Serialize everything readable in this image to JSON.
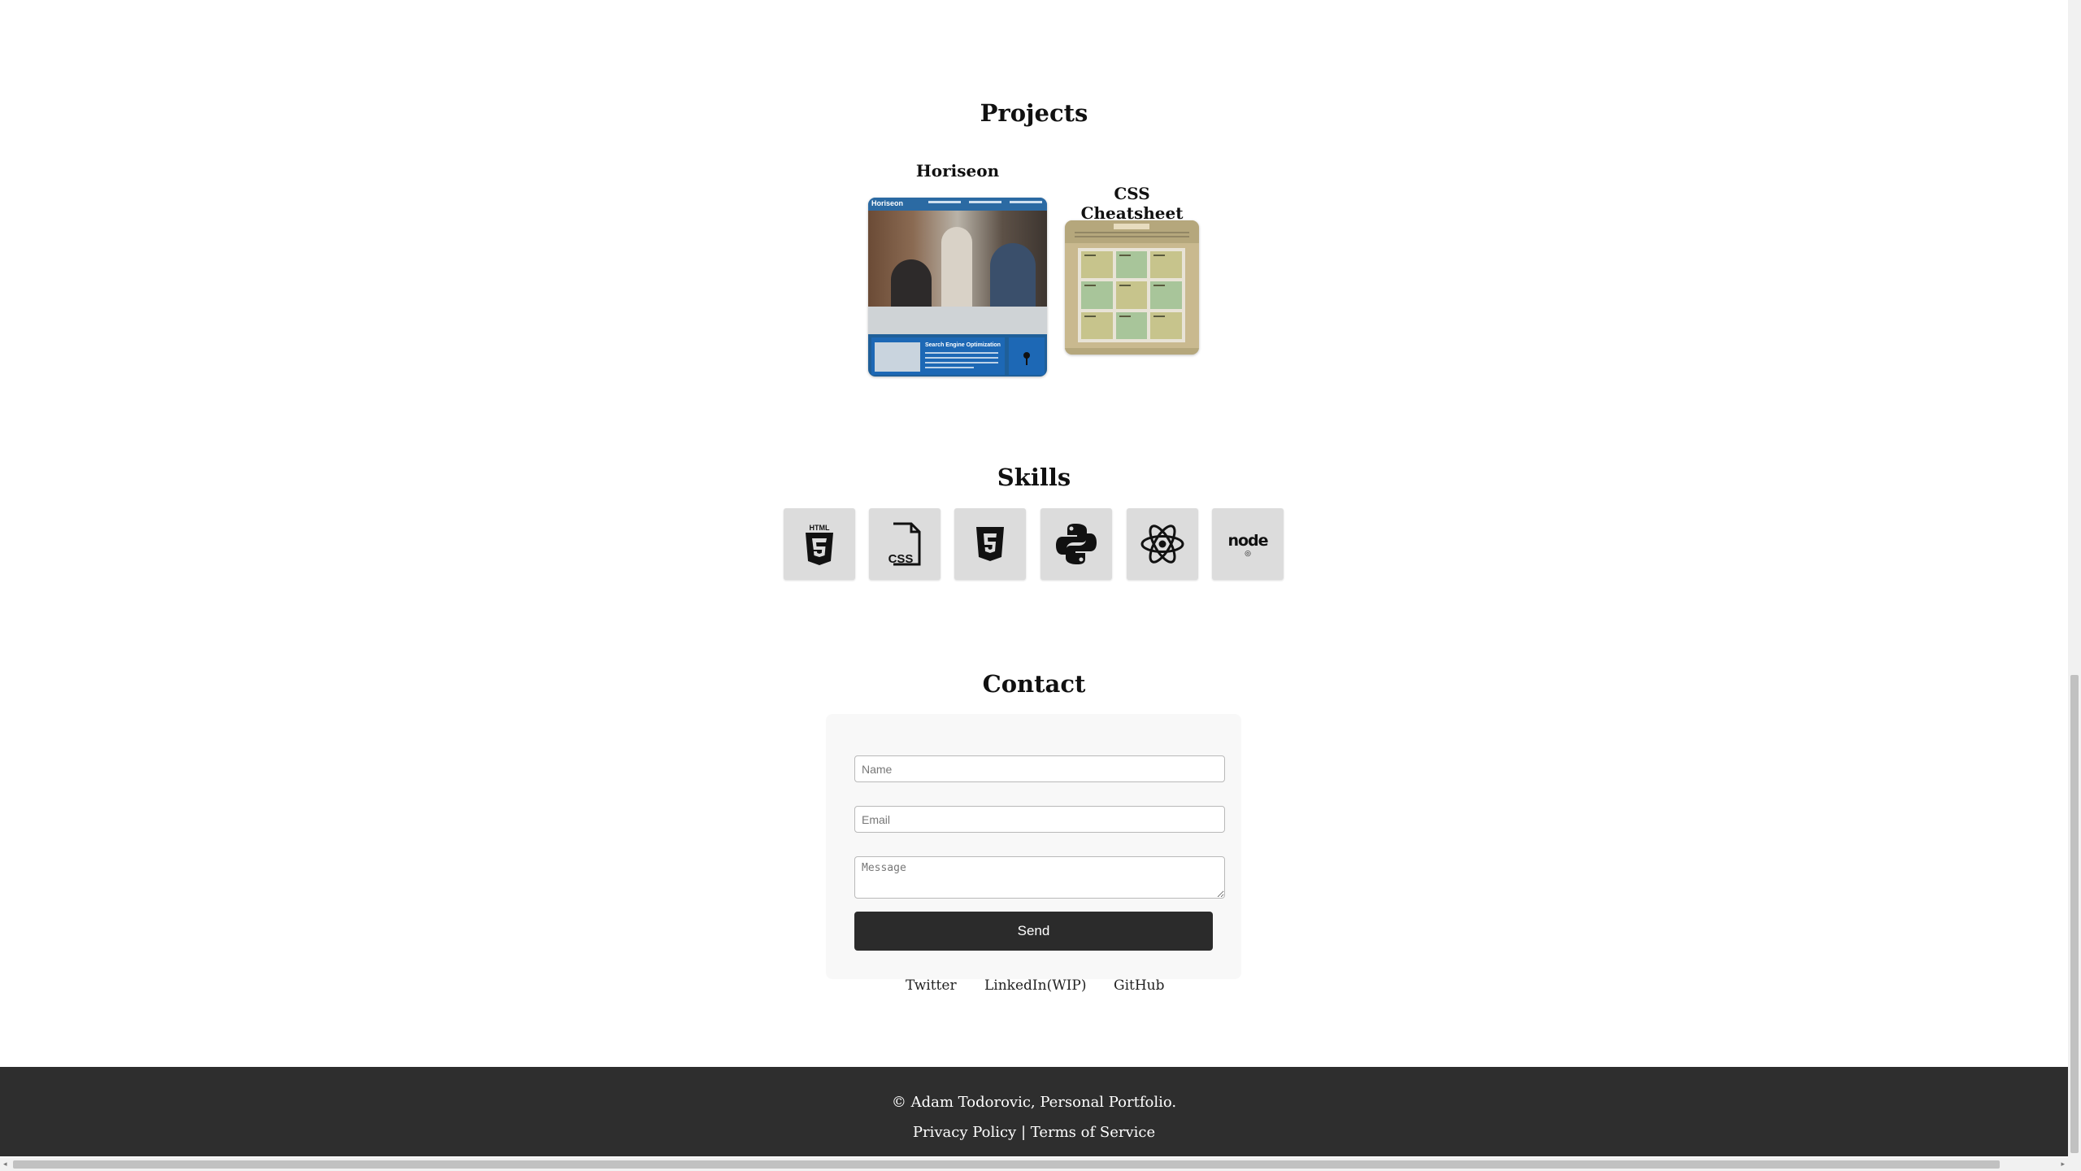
{
  "projects": {
    "title": "Projects",
    "items": [
      {
        "title": "Horiseon",
        "thumb_logo": "Horiseon",
        "thumb_card_title": "Search Engine Optimization"
      },
      {
        "title": "CSS Cheatsheet"
      }
    ]
  },
  "skills": {
    "title": "Skills",
    "items": [
      {
        "icon": "html5-icon",
        "icon_text": "HTML"
      },
      {
        "icon": "css-icon",
        "icon_text": "CSS"
      },
      {
        "icon": "javascript-shield-icon",
        "icon_text": "5"
      },
      {
        "icon": "python-icon"
      },
      {
        "icon": "react-icon"
      },
      {
        "icon": "node-icon",
        "icon_text": "node"
      }
    ]
  },
  "contact": {
    "title": "Contact",
    "name_placeholder": "Name",
    "email_placeholder": "Email",
    "message_placeholder": "Message",
    "send_label": "Send",
    "links": [
      "Twitter",
      "LinkedIn(WIP)",
      "GitHub"
    ]
  },
  "footer": {
    "copyright": "© Adam Todorovic, Personal Portfolio.",
    "privacy": "Privacy Policy",
    "separator": "|",
    "terms": "Terms of Service"
  },
  "colors": {
    "footer_bg": "#2e2e2e",
    "button_bg": "#2b2b2b",
    "tile_bg": "#dcdcdc"
  }
}
